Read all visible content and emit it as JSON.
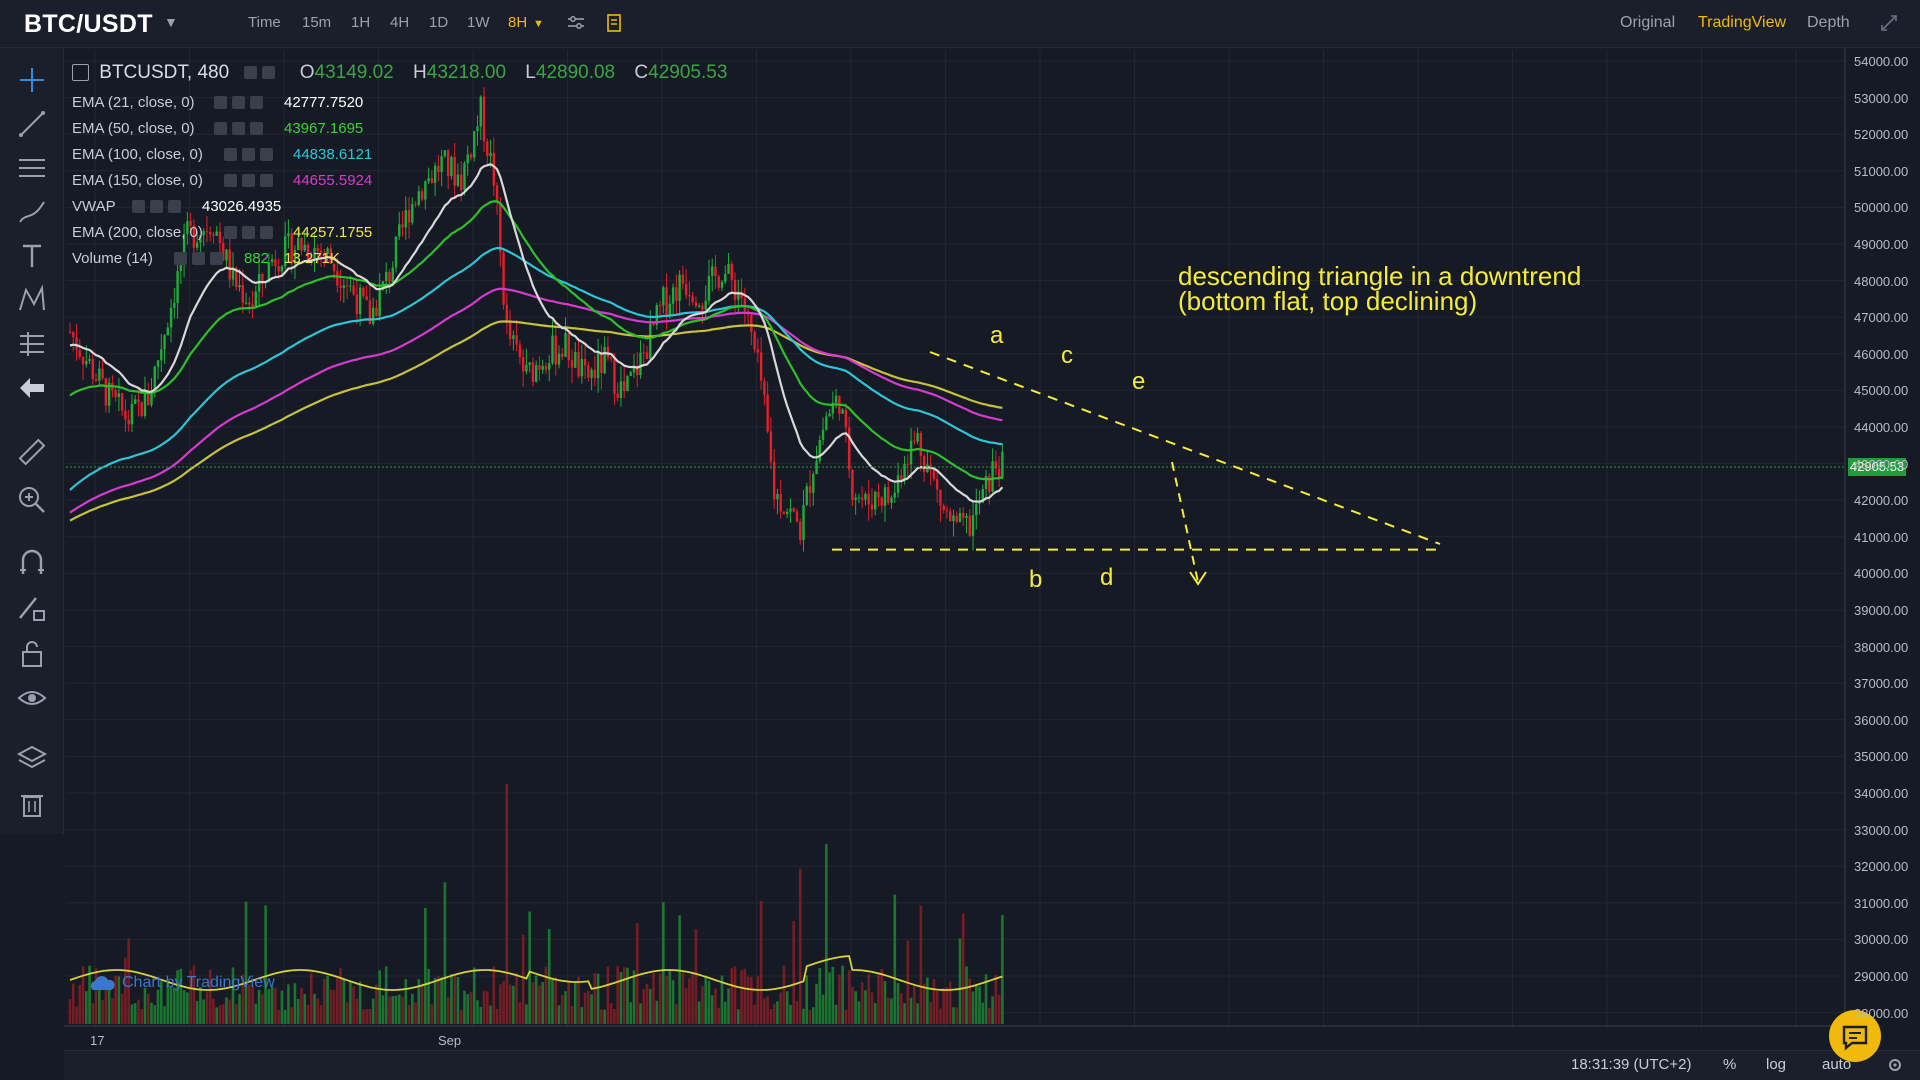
{
  "header": {
    "symbol": "BTC/USDT",
    "timeframes": [
      {
        "label": "Time",
        "active": false
      },
      {
        "label": "15m",
        "active": false
      },
      {
        "label": "1H",
        "active": false
      },
      {
        "label": "4H",
        "active": false
      },
      {
        "label": "1D",
        "active": false
      },
      {
        "label": "1W",
        "active": false
      },
      {
        "label": "8H",
        "active": true
      }
    ],
    "views": [
      {
        "label": "Original",
        "active": false
      },
      {
        "label": "TradingView",
        "active": true
      },
      {
        "label": "Depth",
        "active": false
      }
    ]
  },
  "sidebar": {
    "tools": [
      "crosshair-icon",
      "trendline-icon",
      "fib-icon",
      "brush-icon",
      "text-icon",
      "pattern-icon",
      "prediction-icon",
      "back-arrow-icon",
      "ruler-icon",
      "zoom-in-icon",
      "magnet-icon",
      "draw-lock-icon",
      "lock-icon",
      "eye-icon",
      "layers-icon",
      "trash-icon"
    ]
  },
  "legend": {
    "symbol": "BTCUSDT, 480",
    "open_key": "O",
    "open": "43149.02",
    "high_key": "H",
    "high": "43218.00",
    "low_key": "L",
    "low": "42890.08",
    "close_key": "C",
    "close": "42905.53",
    "indicators": [
      {
        "name": "EMA (21, close, 0)",
        "value": "42777.7520",
        "color": "#ffffff"
      },
      {
        "name": "EMA (50, close, 0)",
        "value": "43967.1695",
        "color": "#3fd13a"
      },
      {
        "name": "EMA (100, close, 0)",
        "value": "44838.6121",
        "color": "#2ec6d6"
      },
      {
        "name": "EMA (150, close, 0)",
        "value": "44655.5924",
        "color": "#d63bd1"
      },
      {
        "name": "VWAP",
        "value": "43026.4935",
        "color": "#ffffff"
      },
      {
        "name": "EMA (200, close, 0)",
        "value": "44257.1755",
        "color": "#f1e64a"
      },
      {
        "name": "Volume (14)",
        "value": "882",
        "value2": "13.271K",
        "color": "#3fd13a",
        "color2": "#f1e64a"
      }
    ]
  },
  "annotation": {
    "title_line1": "descending triangle in a downtrend",
    "title_line2": "(bottom flat, top declining)",
    "waves": [
      "a",
      "b",
      "c",
      "d",
      "e"
    ],
    "color": "#f4eb3c"
  },
  "chart_data": {
    "type": "candlestick",
    "price_axis_ticks": [
      "54000.00",
      "53000.00",
      "52000.00",
      "51000.00",
      "50000.00",
      "49000.00",
      "48000.00",
      "47000.00",
      "46000.00",
      "45000.00",
      "44000.00",
      "43000.00",
      "42000.00",
      "41000.00",
      "40000.00",
      "39000.00",
      "38000.00",
      "37000.00",
      "36000.00",
      "35000.00",
      "34000.00",
      "33000.00",
      "32000.00",
      "31000.00",
      "30000.00",
      "29000.00",
      "28000.00"
    ],
    "current_price": "42905.53",
    "time_axis_ticks": [
      "17",
      "Sep"
    ],
    "ylim": [
      27500,
      54300
    ],
    "pivots": [
      {
        "label": "a",
        "value": 45100
      },
      {
        "label": "b",
        "value": 40650
      },
      {
        "label": "c",
        "value": 44700
      },
      {
        "label": "d",
        "value": 40800
      },
      {
        "label": "e",
        "value": 43900
      }
    ],
    "triangle_support": 40650,
    "up_color": "#1fad3a",
    "down_color": "#e41e2a"
  },
  "status": {
    "time": "18:31:39 (UTC+2)",
    "percent": "%",
    "log": "log",
    "auto": "auto"
  },
  "watermark": "Chart by TradingView",
  "colors": {
    "accent": "#f0b90b",
    "bg": "#161a25",
    "panel": "#1b1f2b"
  }
}
